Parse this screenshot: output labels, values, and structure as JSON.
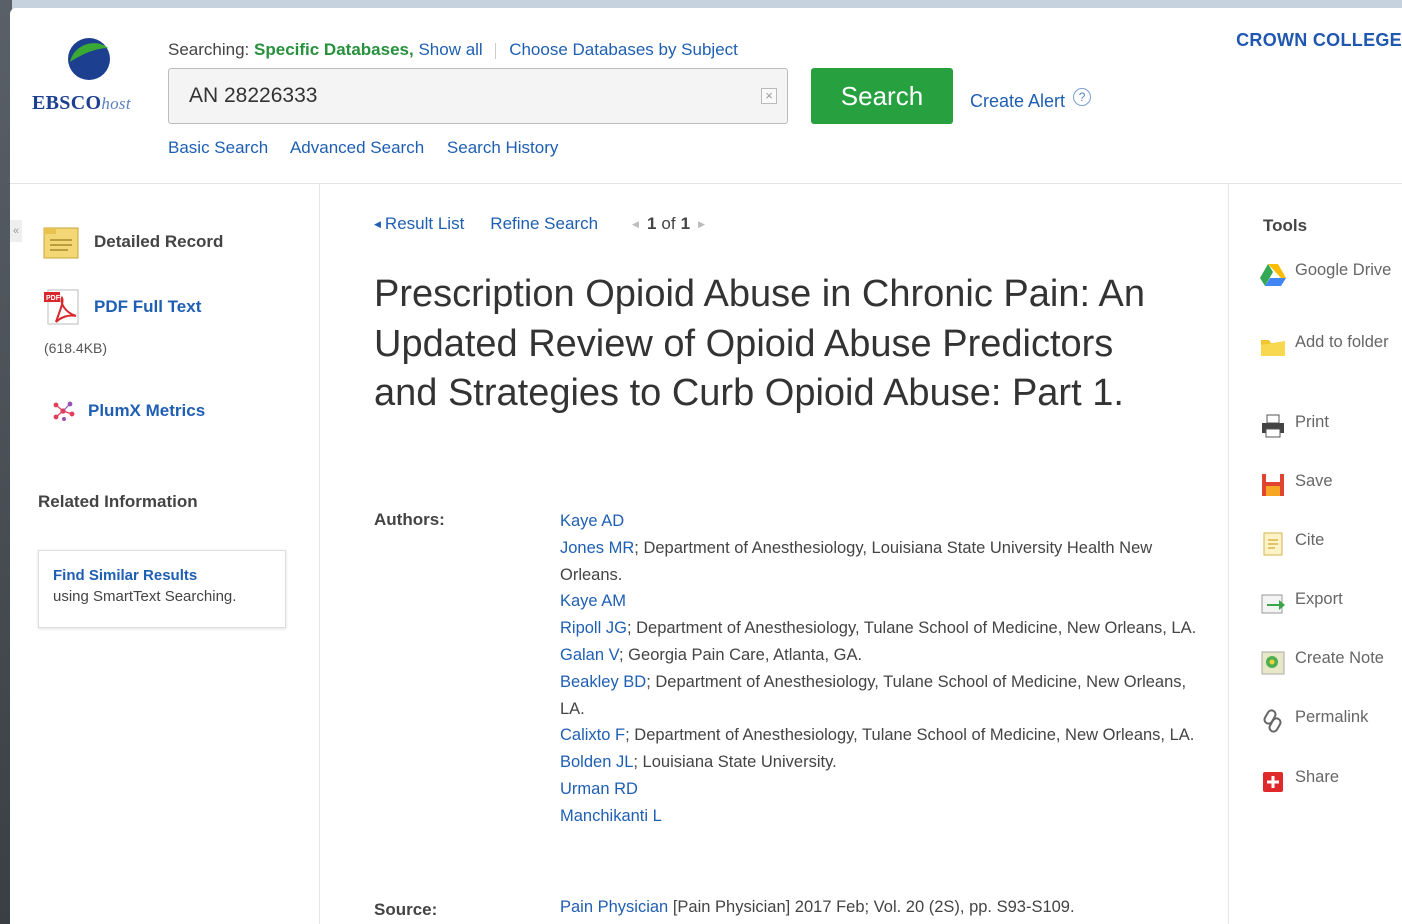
{
  "brand": {
    "logo_text": "EBSCO",
    "logo_suffix": "host",
    "institution": "CROWN COLLEGE",
    "colors": {
      "green": "#27a140",
      "link": "#1f5fb3",
      "navy": "#1d3f8f"
    }
  },
  "search": {
    "searching_label": "Searching:",
    "database_label": "Specific Databases,",
    "show_all": "Show all",
    "choose_databases": "Choose Databases by Subject",
    "query": "AN 28226333",
    "clear_label": "×",
    "button_label": "Search",
    "create_alert": "Create Alert",
    "help": "?",
    "links": [
      "Basic Search",
      "Advanced Search",
      "Search History"
    ]
  },
  "sidebar": {
    "collapse": "«",
    "detailed_record": "Detailed Record",
    "pdf_full_text": "PDF Full Text",
    "pdf_size": "(618.4KB)",
    "plumx": "PlumX Metrics",
    "related_title": "Related Information",
    "similar_title": "Find Similar Results",
    "similar_sub": "using SmartText Searching."
  },
  "nav": {
    "result_list": "Result List",
    "refine_search": "Refine Search",
    "pager_current": "1",
    "pager_of": "of",
    "pager_total": "1"
  },
  "record": {
    "title": "Prescription Opioid Abuse in Chronic Pain: An Updated Review of Opioid Abuse Predictors and Strategies to Curb Opioid Abuse: Part 1.",
    "authors_label": "Authors:",
    "authors": [
      {
        "name": "Kaye AD",
        "affiliation": ""
      },
      {
        "name": "Jones MR",
        "affiliation": "; Department of Anesthesiology, Louisiana State University Health New Orleans."
      },
      {
        "name": "Kaye AM",
        "affiliation": ""
      },
      {
        "name": "Ripoll JG",
        "affiliation": "; Department of Anesthesiology, Tulane School of Medicine, New Orleans, LA."
      },
      {
        "name": "Galan V",
        "affiliation": "; Georgia Pain Care, Atlanta, GA."
      },
      {
        "name": "Beakley BD",
        "affiliation": "; Department of Anesthesiology, Tulane School of Medicine, New Orleans, LA."
      },
      {
        "name": "Calixto F",
        "affiliation": "; Department of Anesthesiology, Tulane School of Medicine, New Orleans, LA."
      },
      {
        "name": "Bolden JL",
        "affiliation": "; Louisiana State University."
      },
      {
        "name": "Urman RD",
        "affiliation": ""
      },
      {
        "name": "Manchikanti L",
        "affiliation": ""
      }
    ],
    "source_label": "Source:",
    "source_link": "Pain Physician",
    "source_rest": " [Pain Physician] 2017 Feb; Vol. 20 (2S), pp. S93-S109."
  },
  "tools": {
    "title": "Tools",
    "items": [
      {
        "label": "Google Drive",
        "icon": "google-drive-icon"
      },
      {
        "label": "Add to folder",
        "icon": "folder-icon"
      },
      {
        "label": "Print",
        "icon": "printer-icon"
      },
      {
        "label": "Save",
        "icon": "save-icon"
      },
      {
        "label": "Cite",
        "icon": "cite-icon"
      },
      {
        "label": "Export",
        "icon": "export-icon"
      },
      {
        "label": "Create Note",
        "icon": "note-icon"
      },
      {
        "label": "Permalink",
        "icon": "link-icon"
      },
      {
        "label": "Share",
        "icon": "share-icon"
      }
    ]
  }
}
